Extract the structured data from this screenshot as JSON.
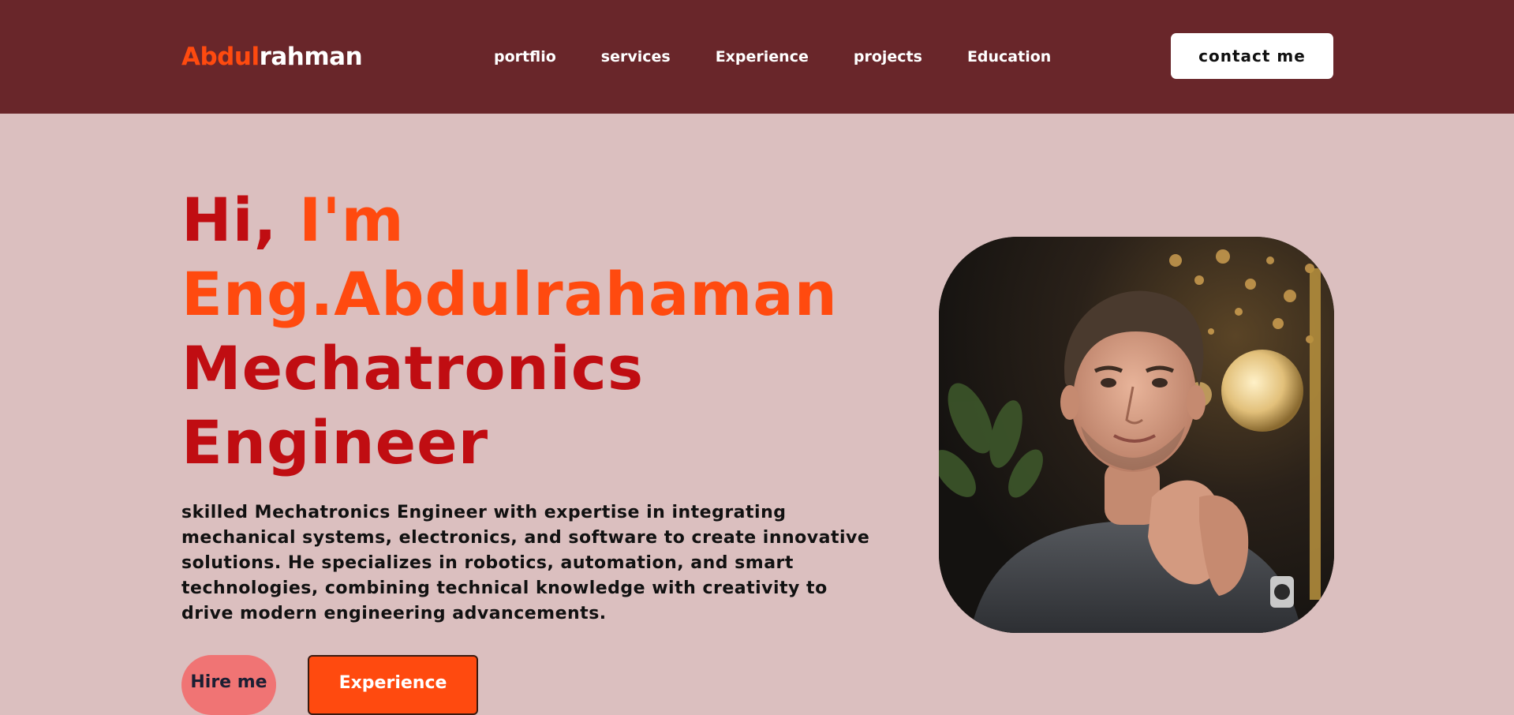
{
  "header": {
    "logo_part1": "Abdul",
    "logo_part2": "rahman",
    "nav": [
      "portflio",
      "services",
      "Experience",
      "projects",
      "Education"
    ],
    "contact_label": "contact me"
  },
  "hero": {
    "title_line1_a": "Hi, ",
    "title_line1_b": "I'm",
    "title_line2": "Eng.Abdulrahaman",
    "title_line3": "Mechatronics",
    "title_line4": "Engineer",
    "description": "skilled Mechatronics Engineer with expertise in integrating mechanical systems, electronics, and software to create innovative solutions. He specializes in robotics, automation, and smart technologies, combining technical knowledge with creativity to drive modern engineering advancements.",
    "hire_label": "Hire me",
    "experience_label": "Experience"
  },
  "colors": {
    "navbar": "#69262a",
    "page_bg": "#dbbfbf",
    "accent_orange": "#ff4a0f",
    "accent_red": "#c00d12",
    "hire_button": "#f07474"
  }
}
